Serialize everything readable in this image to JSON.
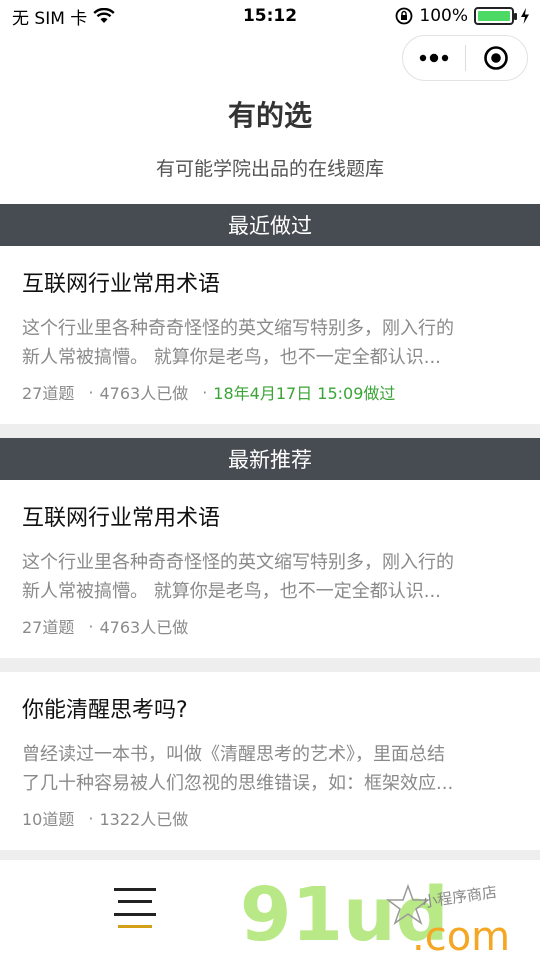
{
  "status_bar": {
    "carrier": "无 SIM 卡",
    "time": "15:12",
    "battery_percent": "100%",
    "battery_level": 1.0,
    "icons": [
      "wifi-icon",
      "lock-rotation-icon",
      "battery-icon",
      "charging-icon"
    ]
  },
  "capsule": {
    "icons": [
      "more-icon",
      "close-target-icon"
    ]
  },
  "header": {
    "title": "有的选",
    "subtitle": "有可能学院出品的在线题库"
  },
  "recent": {
    "section_label": "最近做过",
    "card": {
      "title": "互联网行业常用术语",
      "desc_line1": "这个行业里各种奇奇怪怪的英文缩写特别多，刚入行的",
      "desc_line2": "新人常被搞懵。 就算你是老鸟，也不一定全都认识...",
      "questions": "27道题",
      "people": "4763人已做",
      "done_time": "18年4月17日 15:09做过"
    }
  },
  "recommend": {
    "section_label": "最新推荐",
    "cards": [
      {
        "title": "互联网行业常用术语",
        "desc_line1": "这个行业里各种奇奇怪怪的英文缩写特别多，刚入行的",
        "desc_line2": "新人常被搞懵。 就算你是老鸟，也不一定全都认识...",
        "questions": "27道题",
        "people": "4763人已做"
      },
      {
        "title": "你能清醒思考吗?",
        "desc_line1": "曾经读过一本书，叫做《清醒思考的艺术》，里面总结",
        "desc_line2": "了几十种容易被人们忽视的思维错误，如：框架效应...",
        "questions": "10道题",
        "people": "1322人已做"
      }
    ]
  },
  "meta_separator": "·",
  "bottom": {
    "icon": "menu-icon",
    "watermark_main": "91ud",
    "watermark_domain": ".com",
    "watermark_tag": "小程序商店"
  },
  "colors": {
    "section_bg": "#474c52",
    "done_green": "#3aa536",
    "watermark_green": "#b8e986",
    "watermark_orange": "#f5a623"
  }
}
